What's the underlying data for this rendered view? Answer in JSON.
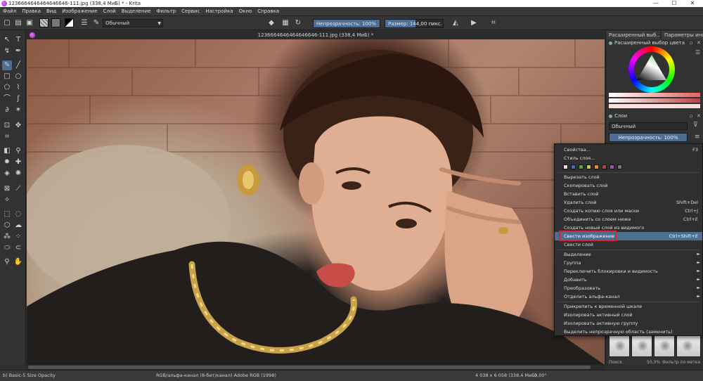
{
  "window": {
    "title": "1236664646464646646-111.jpg (338,4 МиБ) * - Krita",
    "minimize": "—",
    "maximize": "☐",
    "close": "✕"
  },
  "menubar": [
    "Файл",
    "Правка",
    "Вид",
    "Изображение",
    "Слой",
    "Выделение",
    "Фильтр",
    "Сервис",
    "Настройка",
    "Окно",
    "Справка"
  ],
  "toolbar": {
    "blend_mode": "Обычный",
    "opacity_label": "Непрозрачность: 100%",
    "opacity_value": 1.0,
    "size_label": "Размер: 144,00 пикс.",
    "size_fill": 0.52
  },
  "document": {
    "tab_title": "1236664646464646646-111.jpg (338,4 МиБ) *"
  },
  "right_panel": {
    "tab1": "Расширенный выб...",
    "tab2": "Параметры инст...",
    "color_header": "Расширенный выбор цвета",
    "layers_header": "Слои",
    "layers_blend": "Обычный",
    "layers_opacity": "Непрозрачность:  100%",
    "brush_filter_placeholder": "Поиск",
    "zoom_value": "50,0%",
    "filter_by_tag": "Фильтр по метке"
  },
  "context_menu": {
    "items": [
      {
        "label": "Свойства...",
        "shortcut": "F3"
      },
      {
        "label": "Стиль слоя...",
        "shortcut": ""
      },
      {
        "label": "Вырезать слой",
        "shortcut": ""
      },
      {
        "label": "Скопировать слой",
        "shortcut": ""
      },
      {
        "label": "Вставить слой",
        "shortcut": ""
      },
      {
        "label": "Удалить слой",
        "shortcut": "Shift+Del"
      },
      {
        "label": "Создать копию слоя или маски",
        "shortcut": "Ctrl+J"
      },
      {
        "label": "Объединить со слоем ниже",
        "shortcut": "Ctrl+E"
      },
      {
        "label": "Создать новый слой из видимого",
        "shortcut": ""
      },
      {
        "label": "Свести изображение",
        "shortcut": "Ctrl+Shift+E"
      },
      {
        "label": "Свести слой",
        "shortcut": ""
      },
      {
        "label": "Выделение",
        "shortcut": ""
      },
      {
        "label": "Группа",
        "shortcut": ""
      },
      {
        "label": "Переключить блокировки и видимость",
        "shortcut": ""
      },
      {
        "label": "Добавить",
        "shortcut": ""
      },
      {
        "label": "Преобразовать",
        "shortcut": ""
      },
      {
        "label": "Отделить альфа-канал",
        "shortcut": ""
      },
      {
        "label": "Прикрепить к временной шкале",
        "shortcut": ""
      },
      {
        "label": "Изолировать активный слой",
        "shortcut": ""
      },
      {
        "label": "Изолировать активную группу",
        "shortcut": ""
      },
      {
        "label": "Выделить непрозрачную область (заменить)",
        "shortcut": ""
      }
    ],
    "label_colors": [
      "#e0e0e0",
      "#3b6fc2",
      "#57a43c",
      "#d6c233",
      "#e38a2c",
      "#c53b3b",
      "#a34fb0",
      "#777777"
    ],
    "highlight_color": "#4d6d92",
    "annotation_color": "#e0202a"
  },
  "statusbar": {
    "brush": "b) Basic-5 Size Opacity",
    "colorspace": "RGB/альфа-канал (8-бит/канал)  Adobe RGB (1998)",
    "dimensions": "4 038 x 6 058 (338,4 МиБ)",
    "rotation": "0,00°"
  }
}
